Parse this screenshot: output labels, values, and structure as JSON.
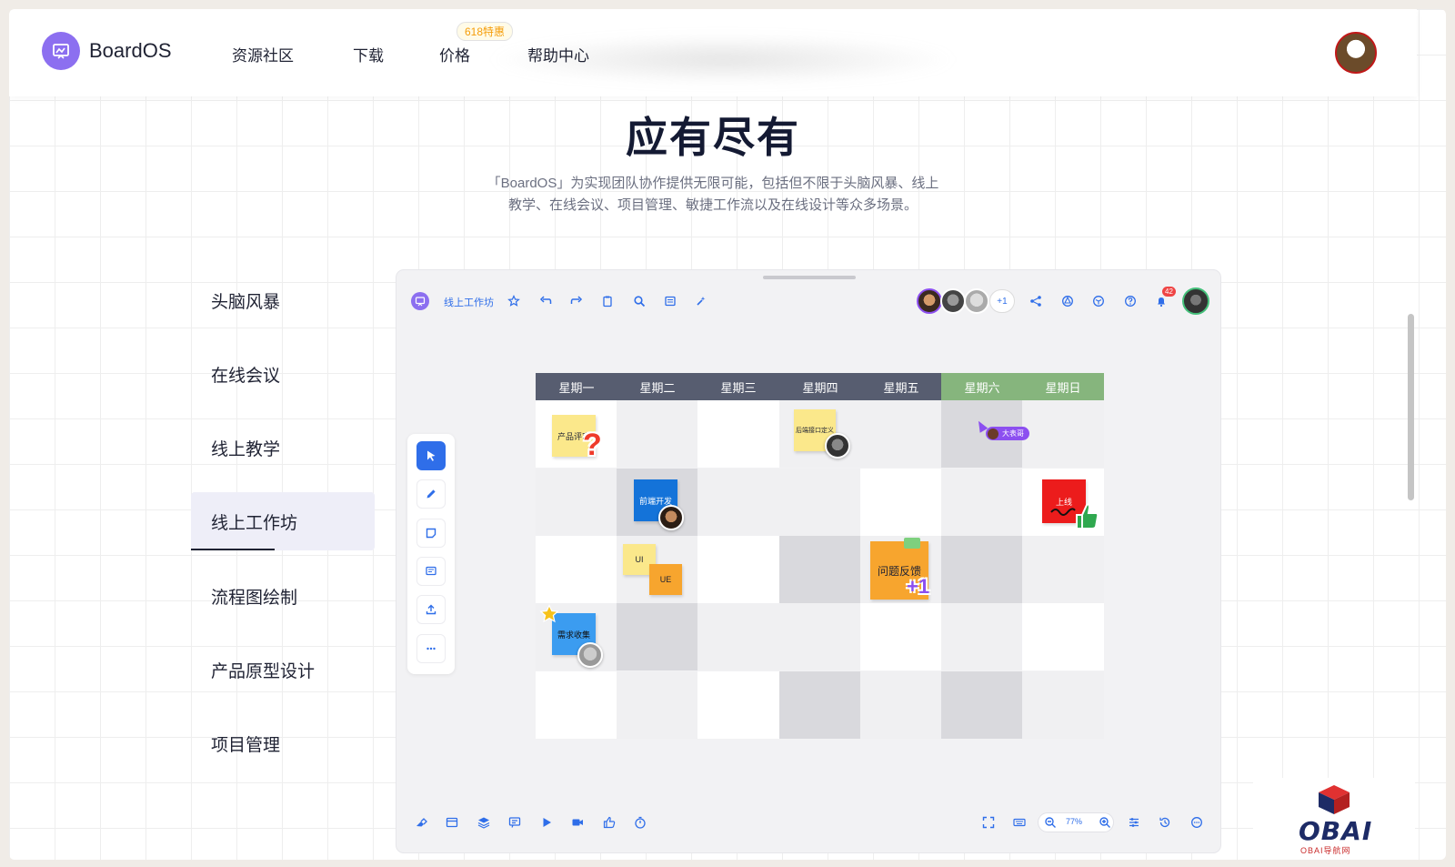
{
  "brand": {
    "name": "BoardOS",
    "accent": "#8c6ff0"
  },
  "nav": {
    "items": [
      "资源社区",
      "下载",
      "价格",
      "帮助中心"
    ],
    "promo_badge": "618特惠"
  },
  "hero": {
    "title": "应有尽有",
    "desc_line1": "「BoardOS」为实现团队协作提供无限可能，包括但不限于头脑风暴、线上",
    "desc_line2": "教学、在线会议、项目管理、敏捷工作流以及在线设计等众多场景。"
  },
  "scenarios": {
    "items": [
      "头脑风暴",
      "在线会议",
      "线上教学",
      "线上工作坊",
      "流程图绘制",
      "产品原型设计",
      "项目管理"
    ],
    "active_index": 3
  },
  "app": {
    "board_title": "线上工作坊",
    "collaborators_extra": "+1",
    "notification_count": "42",
    "zoom": "77%",
    "days": [
      "星期一",
      "星期二",
      "星期三",
      "星期四",
      "星期五",
      "星期六",
      "星期日"
    ],
    "weekday_color": "#575d70",
    "weekend_color": "#86b57d",
    "cursor_user": "大表哥",
    "stickies": {
      "product_review": "产品评审",
      "backend_api": "后端接口定义",
      "frontend_dev": "前端开发",
      "launch": "上线",
      "ui": "UI",
      "ue": "UE",
      "feedback": "问题反馈",
      "requirements": "需求收集",
      "plus_one": "+1"
    },
    "reaction_icons": [
      "question-mark-icon",
      "thumbs-up-icon",
      "star-icon",
      "plus-one-icon"
    ]
  },
  "watermark": {
    "main": "OBAI",
    "sub": "OBAI导航网"
  }
}
